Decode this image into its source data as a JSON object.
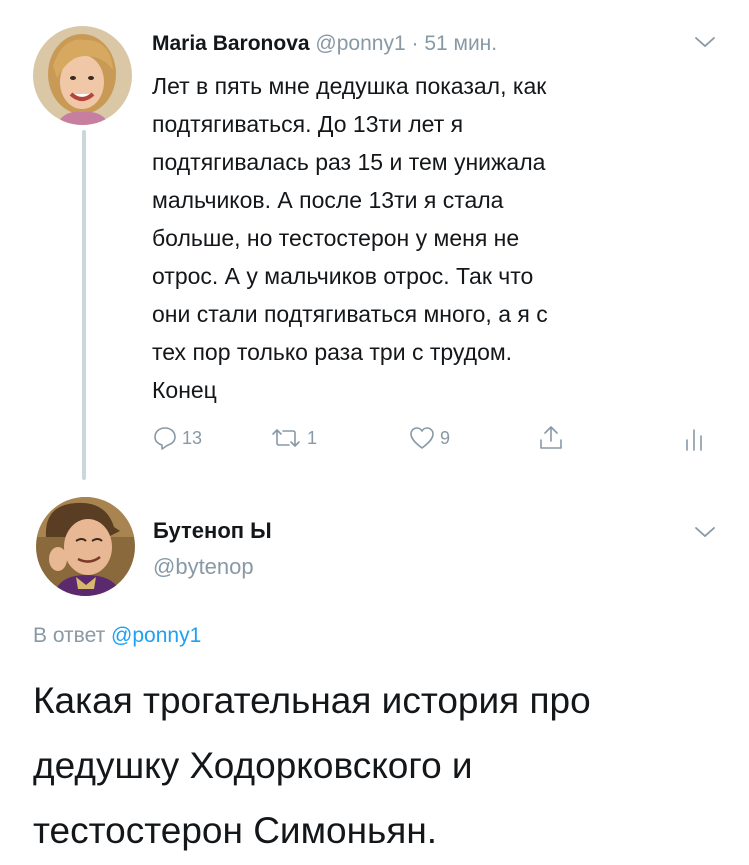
{
  "tweet1": {
    "author_name": "Maria Baronova",
    "author_handle": "@ponny1",
    "separator": "·",
    "time": "51 мин.",
    "text_lines": [
      "Лет в пять мне дедушка показал, как",
      "подтягиваться. До 13ти лет я",
      "подтягивалась раз 15 и тем унижала",
      "мальчиков. А после 13ти я стала",
      "больше, но тестостерон у меня не",
      "отрос. А у мальчиков отрос. Так что",
      "они стали подтягиваться много, а я с",
      "тех пор только раза три с трудом.",
      "Конец"
    ],
    "actions": {
      "replies": "13",
      "retweets": "1",
      "likes": "9"
    }
  },
  "tweet2": {
    "author_name": "Бутеноп Ы",
    "author_handle": "@bytenop",
    "reply_prefix": "В ответ",
    "reply_handle": "@ponny1",
    "text_lines": [
      "Какая трогательная история про",
      "дедушку Ходорковского и",
      "тестостерон Симоньян."
    ]
  },
  "colors": {
    "text": "#14171a",
    "muted": "#8899a6",
    "link": "#1da1f2",
    "thread_line": "#ccd6dd"
  },
  "icons": [
    "reply-icon",
    "retweet-icon",
    "heart-icon",
    "share-icon",
    "analytics-icon",
    "chevron-down-icon"
  ]
}
